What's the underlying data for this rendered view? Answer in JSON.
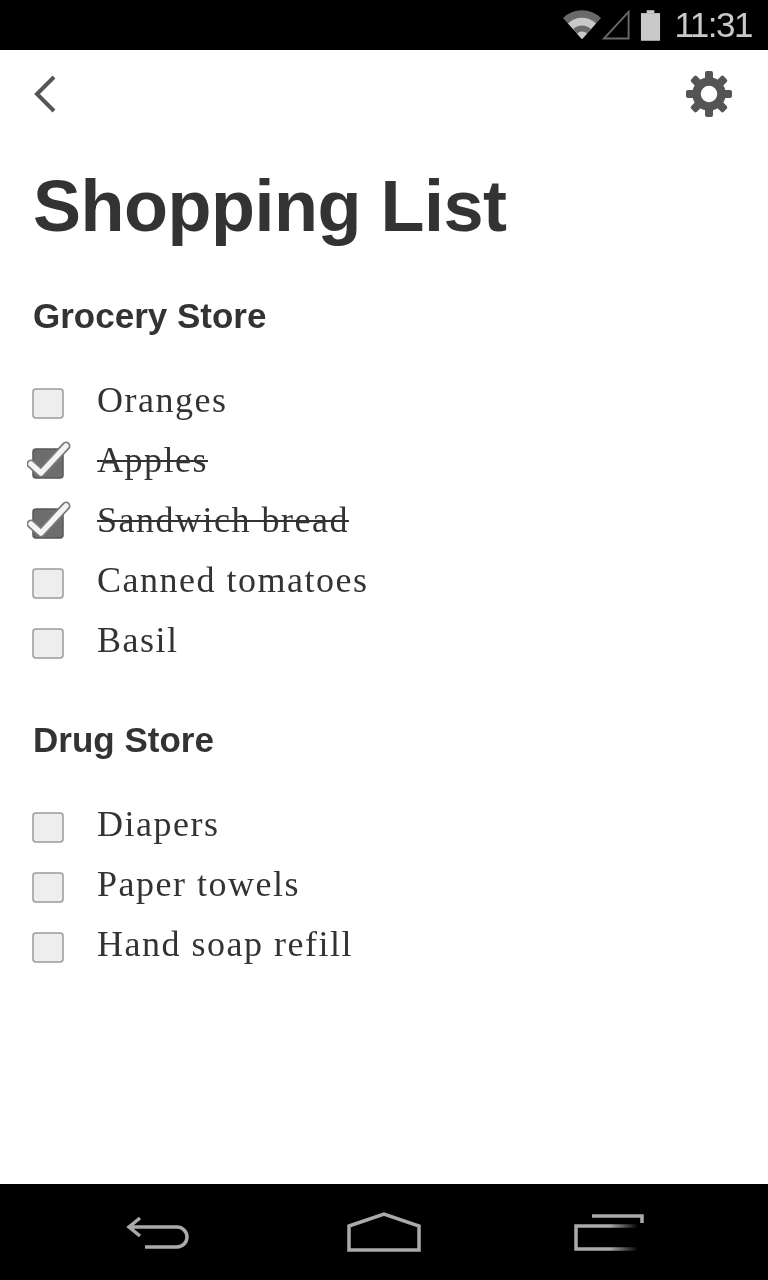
{
  "status_bar": {
    "time": "11:31"
  },
  "title": "Shopping List",
  "sections": [
    {
      "heading": "Grocery Store",
      "items": [
        {
          "label": "Oranges",
          "checked": false
        },
        {
          "label": "Apples",
          "checked": true
        },
        {
          "label": "Sandwich bread",
          "checked": true
        },
        {
          "label": "Canned tomatoes",
          "checked": false
        },
        {
          "label": "Basil",
          "checked": false
        }
      ]
    },
    {
      "heading": "Drug Store",
      "items": [
        {
          "label": "Diapers",
          "checked": false
        },
        {
          "label": "Paper towels",
          "checked": false
        },
        {
          "label": "Hand soap refill",
          "checked": false
        }
      ]
    }
  ]
}
